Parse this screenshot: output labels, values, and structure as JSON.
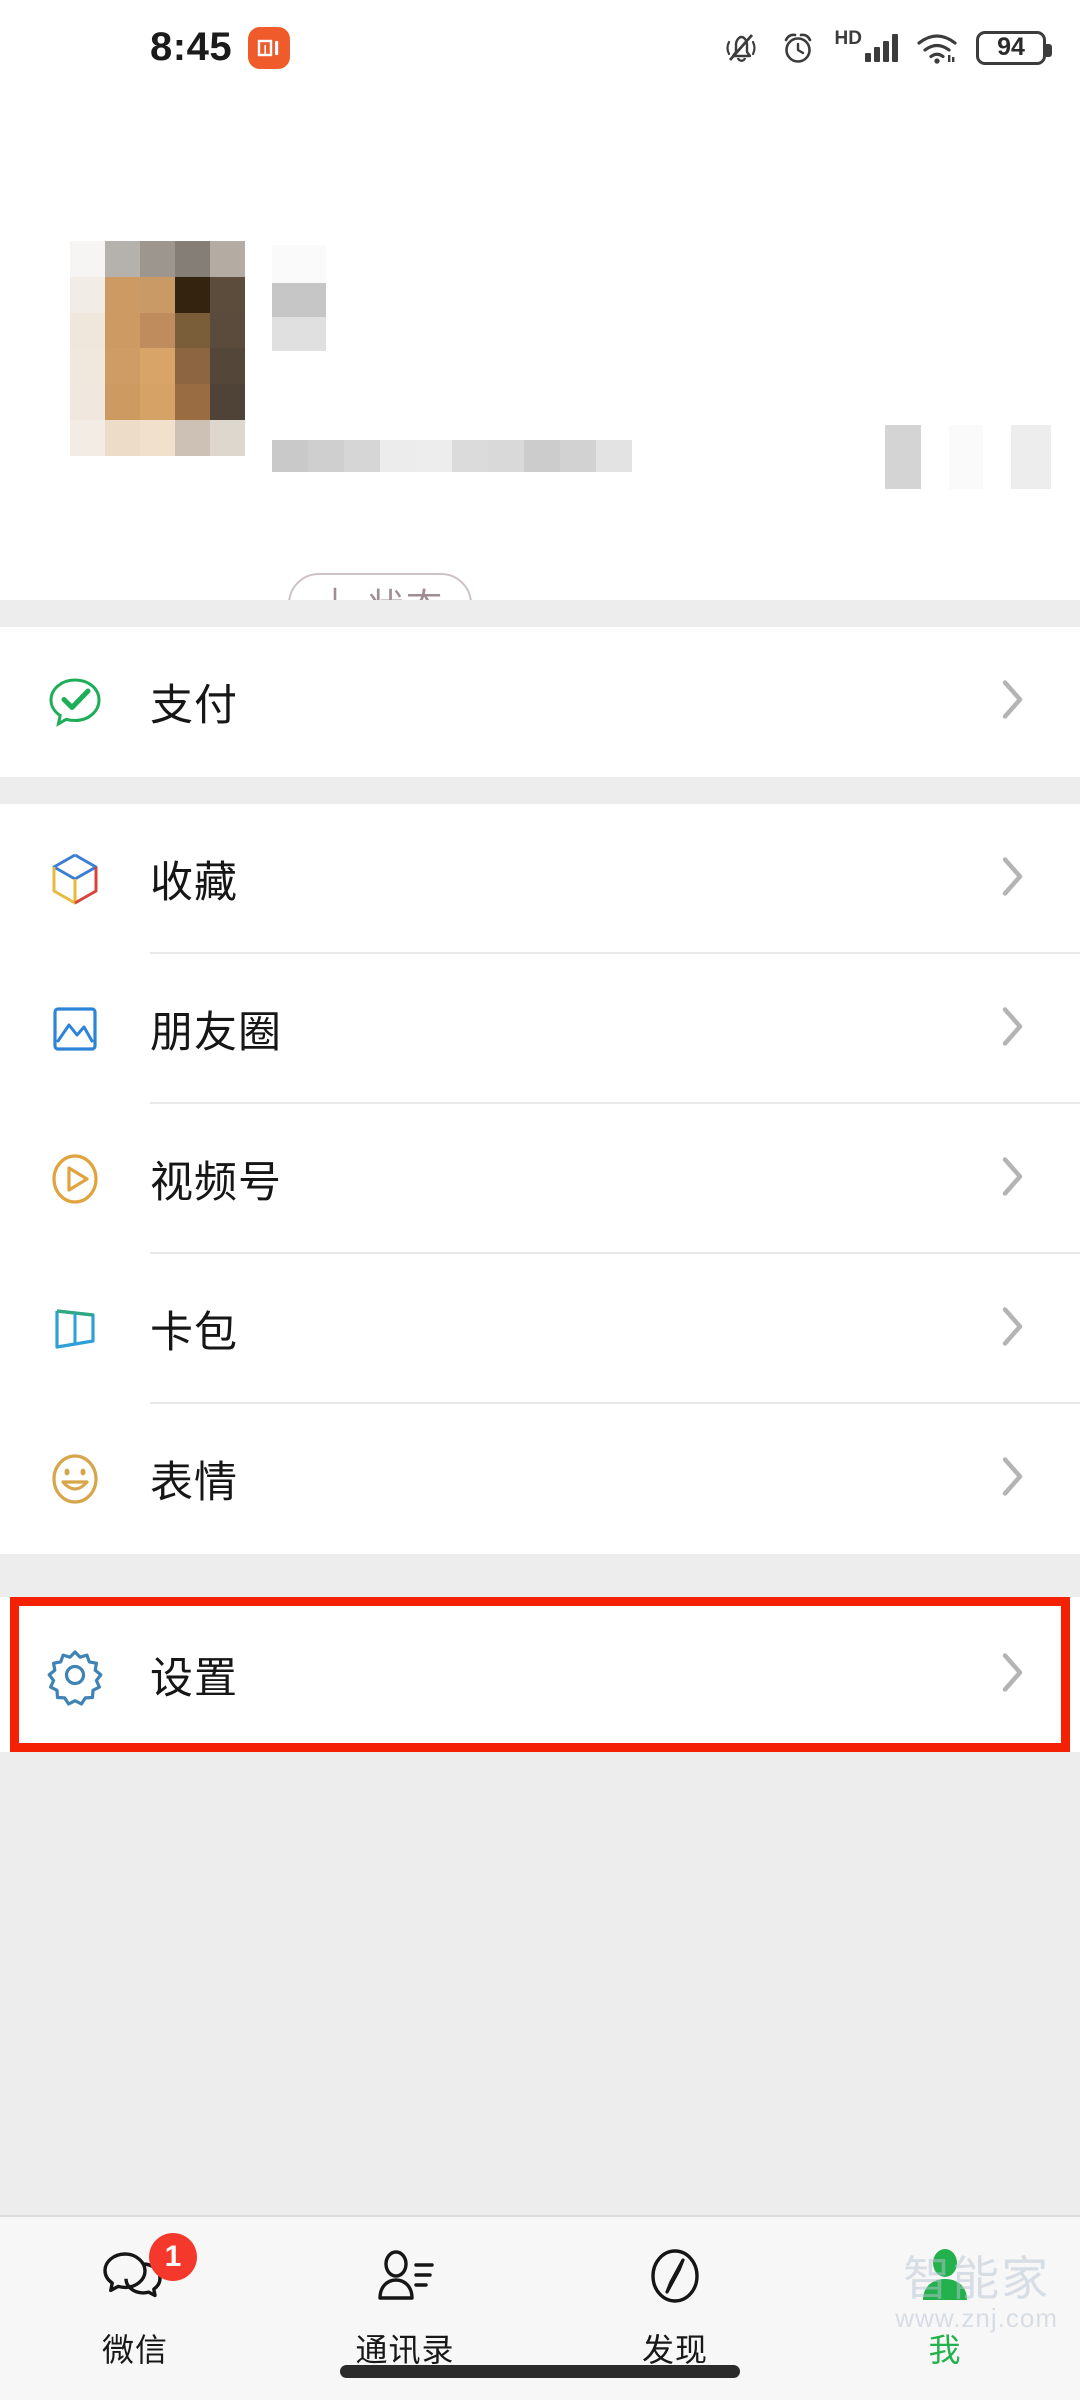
{
  "status_bar": {
    "time": "8:45",
    "brand_badge": "mi",
    "icons": [
      "mute-bell-icon",
      "alarm-clock-icon",
      "hd-signal-icon",
      "wifi-icon",
      "battery-icon"
    ],
    "hd_label": "HD",
    "battery_level": "94"
  },
  "profile": {
    "avatar": "blurred-avatar",
    "name": "",
    "wechat_id": "",
    "qr_code": "blurred-qr-code",
    "status_button": {
      "plus": "＋",
      "label": "状态"
    }
  },
  "sections": [
    {
      "id": "payment",
      "items": [
        {
          "label": "支付",
          "icon": "payment-icon",
          "color": "#1fae58"
        }
      ]
    },
    {
      "id": "services",
      "items": [
        {
          "label": "收藏",
          "icon": "favorites-icon",
          "color": "#3b7fd4"
        },
        {
          "label": "朋友圈",
          "icon": "moments-icon",
          "color": "#2d83d6"
        },
        {
          "label": "视频号",
          "icon": "channels-icon",
          "color": "#e0a33e"
        },
        {
          "label": "卡包",
          "icon": "cards-icon",
          "color": "#2e9fd8"
        },
        {
          "label": "表情",
          "icon": "stickers-icon",
          "color": "#d7a64a"
        }
      ]
    },
    {
      "id": "settings",
      "highlighted": true,
      "items": [
        {
          "label": "设置",
          "icon": "settings-gear-icon",
          "color": "#3f83b5"
        }
      ]
    }
  ],
  "highlight": {
    "color": "#f42105",
    "target": "设置"
  },
  "tabbar": {
    "tabs": [
      {
        "label": "微信",
        "icon": "chat-bubbles-icon",
        "badge": "1",
        "active": false
      },
      {
        "label": "通讯录",
        "icon": "contacts-icon",
        "badge": null,
        "active": false
      },
      {
        "label": "发现",
        "icon": "discover-compass-icon",
        "badge": null,
        "active": false
      },
      {
        "label": "我",
        "icon": "profile-person-icon",
        "badge": null,
        "active": true
      }
    ],
    "active_color": "#22b14c"
  },
  "watermark": {
    "name": "智能家",
    "url": "www.znj.com"
  }
}
